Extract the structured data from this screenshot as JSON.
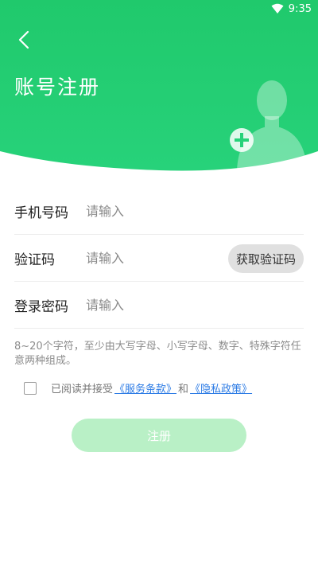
{
  "status_bar": {
    "time": "9:35",
    "wifi_icon": "wifi-icon"
  },
  "header": {
    "title": "账号注册",
    "back_icon": "chevron-left-icon",
    "bg_color": "#22cc70",
    "illustration_icon": "add-user-icon"
  },
  "form": {
    "phone": {
      "label": "手机号码",
      "placeholder": "请输入"
    },
    "code": {
      "label": "验证码",
      "placeholder": "请输入",
      "button_label": "获取验证码"
    },
    "password": {
      "label": "登录密码",
      "placeholder": "请输入"
    },
    "hint": "8~20个字符，至少由大写字母、小写字母、数字、特殊字符任意两种组成。"
  },
  "agreement": {
    "prefix": "已阅读并接受",
    "terms_label": "《服务条款》",
    "and": "和",
    "privacy_label": "《隐私政策》",
    "checked": false
  },
  "register_button": {
    "label": "注册",
    "color": "#b9f0c6"
  }
}
